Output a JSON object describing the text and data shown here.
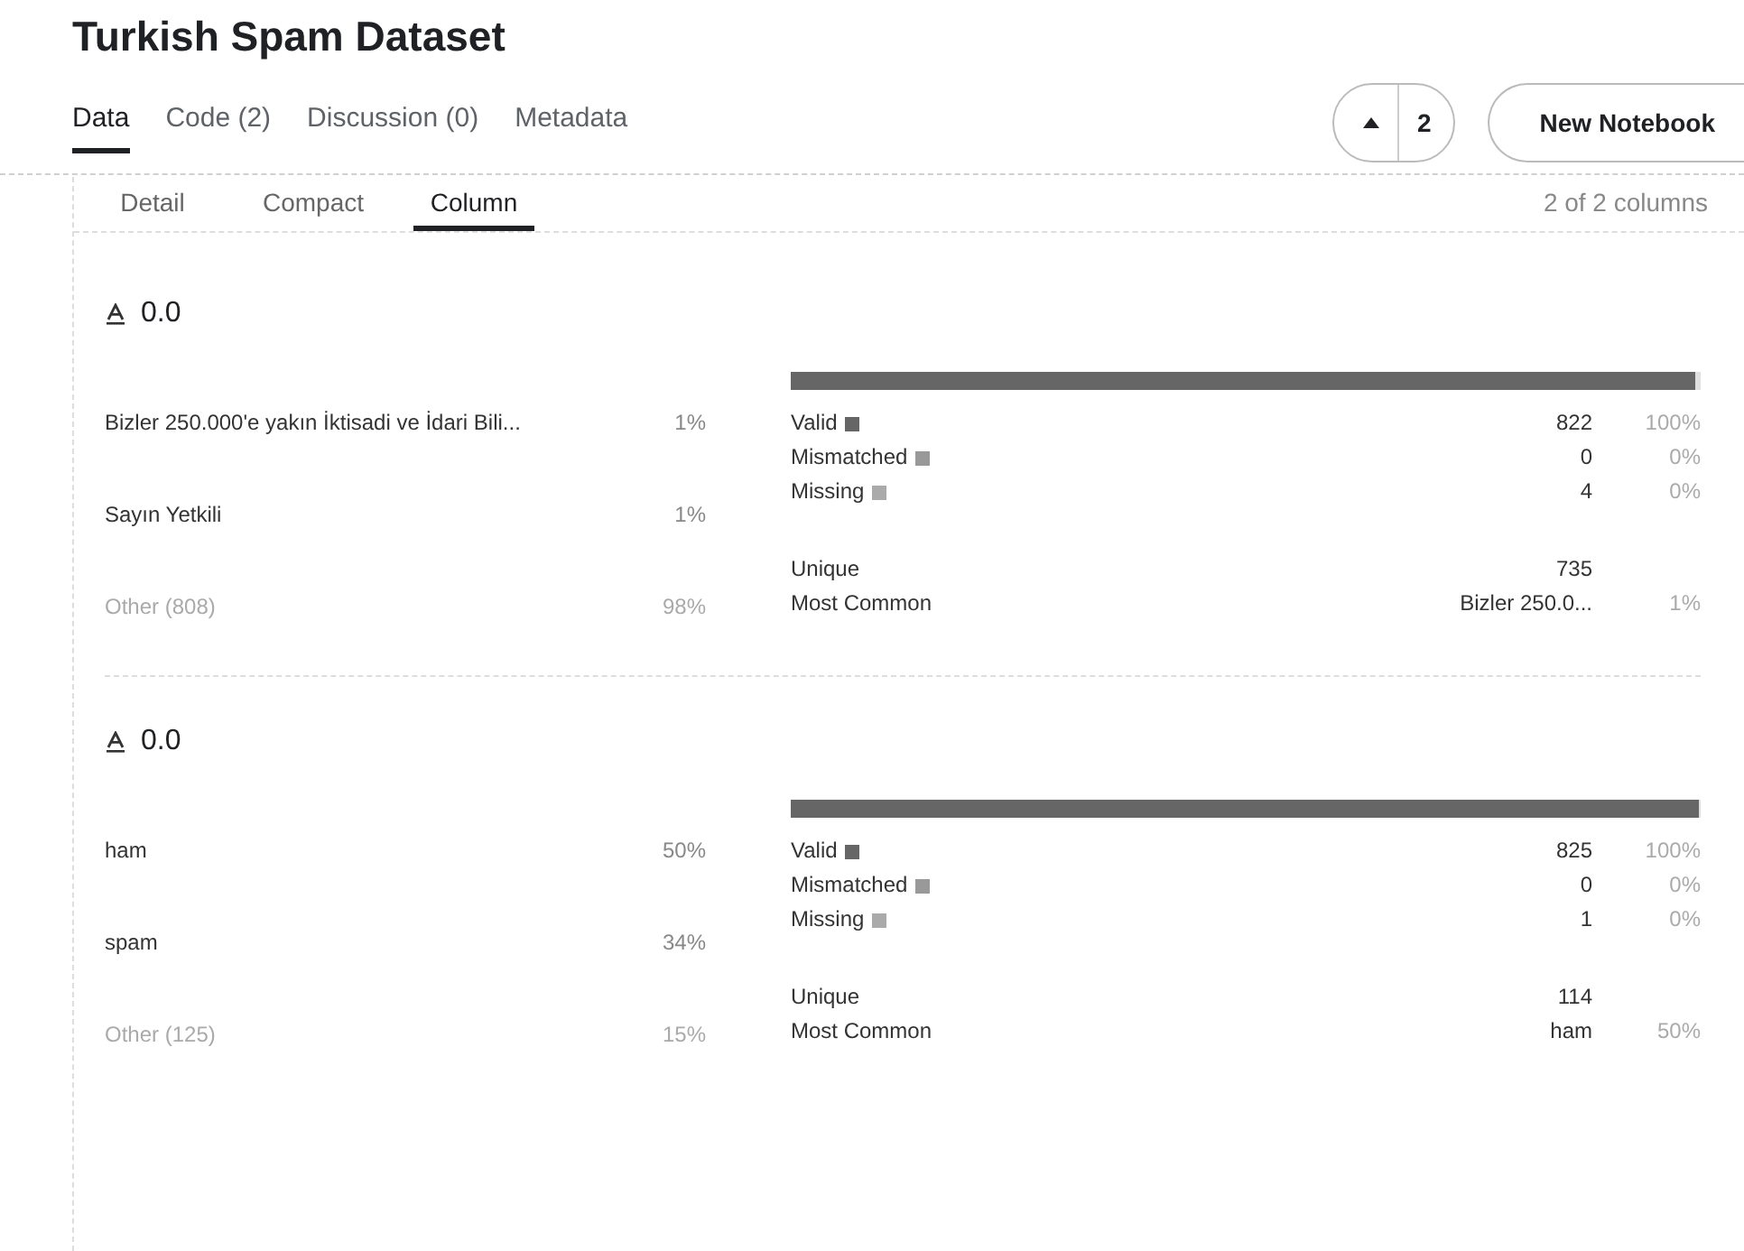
{
  "title": "Turkish Spam Dataset",
  "tabs": [
    {
      "label": "Data",
      "selected": true
    },
    {
      "label": "Code (2)",
      "selected": false
    },
    {
      "label": "Discussion (0)",
      "selected": false
    },
    {
      "label": "Metadata",
      "selected": false
    }
  ],
  "vote": {
    "count": "2"
  },
  "new_notebook": "New Notebook",
  "view_tabs": [
    {
      "label": "Detail",
      "selected": false
    },
    {
      "label": "Compact",
      "selected": false
    },
    {
      "label": "Column",
      "selected": true
    }
  ],
  "column_count": "2 of 2 columns",
  "columns": [
    {
      "name": "0.0",
      "top_values": [
        {
          "label": "Bizler 250.000'e yakın İktisadi ve İdari Bili...",
          "share": "1%",
          "kind": "value"
        },
        {
          "label": "Sayın Yetkili",
          "share": "1%",
          "kind": "value"
        },
        {
          "label": "Other (808)",
          "share": "98%",
          "kind": "other"
        }
      ],
      "bar": {
        "level": 0.995
      },
      "quality": [
        {
          "label": "Valid",
          "color": "#666666",
          "count": "822",
          "share": "100%"
        },
        {
          "label": "Mismatched",
          "color": "#999999",
          "count": "0",
          "share": "0%"
        },
        {
          "label": "Missing",
          "color": "#aaaaaa",
          "count": "4",
          "share": "0%"
        }
      ],
      "unique": {
        "label": "Unique",
        "value": "735"
      },
      "most_common": {
        "label": "Most Common",
        "value": "Bizler 250.0...",
        "share": "1%"
      }
    },
    {
      "name": "0.0",
      "top_values": [
        {
          "label": "ham",
          "share": "50%",
          "kind": "value"
        },
        {
          "label": "spam",
          "share": "34%",
          "kind": "value"
        },
        {
          "label": "Other (125)",
          "share": "15%",
          "kind": "other"
        }
      ],
      "bar": {
        "level": 0.999
      },
      "quality": [
        {
          "label": "Valid",
          "color": "#666666",
          "count": "825",
          "share": "100%"
        },
        {
          "label": "Mismatched",
          "color": "#999999",
          "count": "0",
          "share": "0%"
        },
        {
          "label": "Missing",
          "color": "#aaaaaa",
          "count": "1",
          "share": "0%"
        }
      ],
      "unique": {
        "label": "Unique",
        "value": "114"
      },
      "most_common": {
        "label": "Most Common",
        "value": "ham",
        "share": "50%"
      }
    }
  ]
}
